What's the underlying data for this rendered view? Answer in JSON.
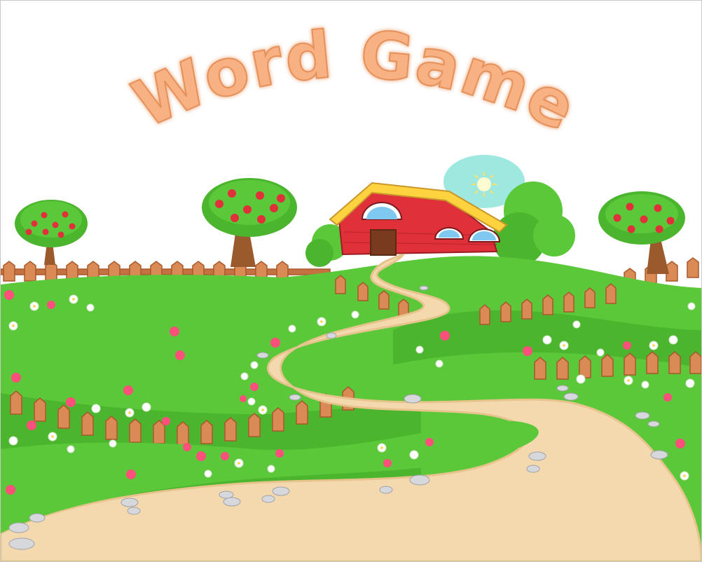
{
  "game": {
    "title": "Word Game"
  },
  "colors": {
    "title_fill": "#f7b183",
    "title_stroke": "#e6915a",
    "grass": "#5bc83a",
    "grass_dark": "#3fa525",
    "path": "#f4d9ae",
    "fence": "#d98a55",
    "barn_red": "#e0313a",
    "roof_yellow": "#ffd23f",
    "sun_halo": "#9fe8e0",
    "sky": "#ffffff"
  },
  "scene": {
    "icons": [
      "barn-icon",
      "sun-icon",
      "apple-tree-icon",
      "fence-icon",
      "flower-icon",
      "pebble-icon"
    ]
  }
}
